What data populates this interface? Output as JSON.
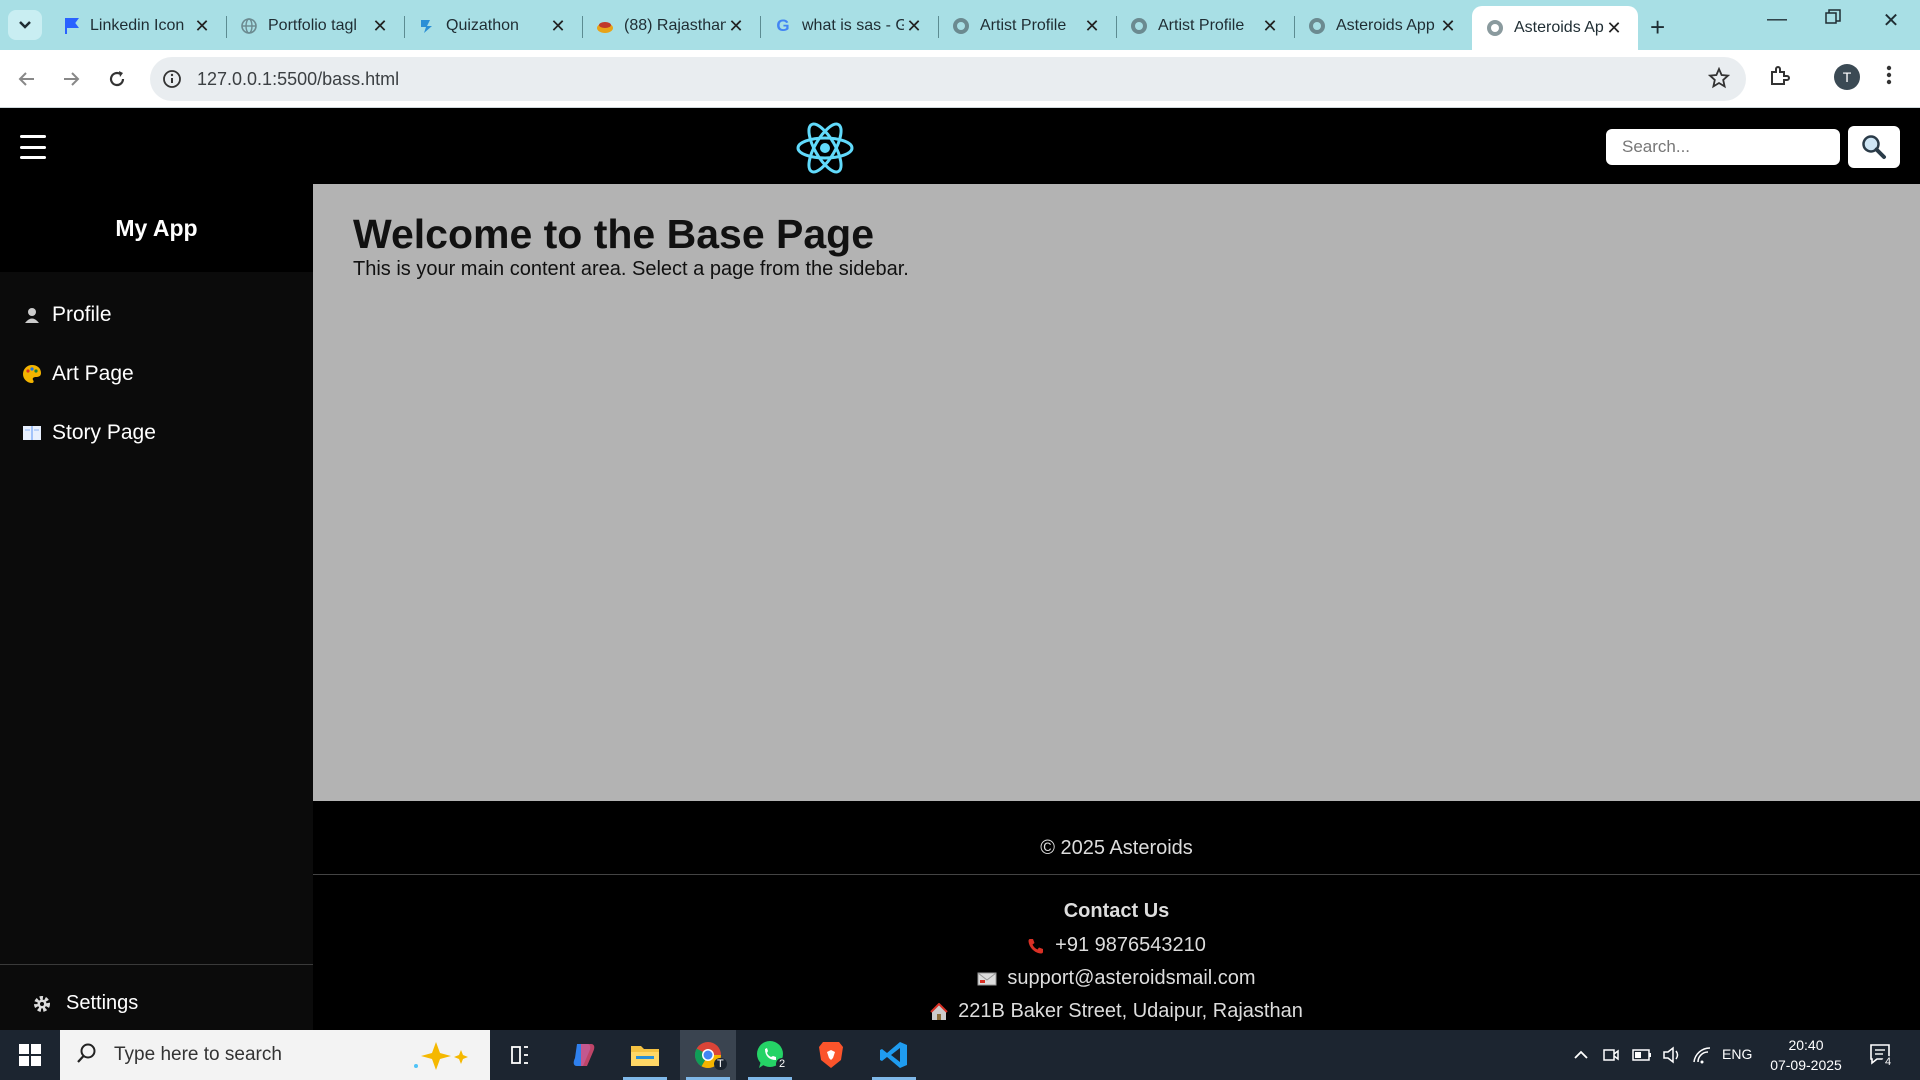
{
  "browser": {
    "tabs": [
      {
        "title": "Linkedin Icon",
        "favicon": "linkedin-flag-icon"
      },
      {
        "title": "Portfolio tagl",
        "favicon": "globe-icon"
      },
      {
        "title": "Quizathon",
        "favicon": "quizathon-icon"
      },
      {
        "title": "(88) Rajasthan",
        "favicon": "food-icon"
      },
      {
        "title": "what is sas - G",
        "favicon": "google-icon"
      },
      {
        "title": "Artist Profile",
        "favicon": "globe-icon"
      },
      {
        "title": "Artist Profile",
        "favicon": "globe-icon"
      },
      {
        "title": "Asteroids App",
        "favicon": "globe-icon"
      },
      {
        "title": "Asteroids App",
        "favicon": "globe-icon",
        "active": true
      }
    ],
    "url": "127.0.0.1:5500/bass.html",
    "profile_initial": "T"
  },
  "header": {
    "search_placeholder": "Search..."
  },
  "sidebar": {
    "title": "My App",
    "items": [
      {
        "label": "Profile",
        "icon": "👤"
      },
      {
        "label": "Art Page",
        "icon": "🎨"
      },
      {
        "label": "Story Page",
        "icon": "📖"
      }
    ],
    "settings_label": "Settings"
  },
  "main": {
    "heading": "Welcome to the Base Page",
    "description": "This is your main content area. Select a page from the sidebar."
  },
  "footer": {
    "copyright": "© 2025 Asteroids",
    "contact_title": "Contact Us",
    "phone": "+91 9876543210",
    "email": "support@asteroidsmail.com",
    "address": "221B Baker Street, Udaipur, Rajasthan"
  },
  "taskbar": {
    "search_placeholder": "Type here to search",
    "whatsapp_badge": "2",
    "chrome_badge": "T",
    "language": "ENG",
    "time": "20:40",
    "date": "07-09-2025",
    "notification_count": "4"
  },
  "colors": {
    "tabstrip": "#a8dfe5",
    "react_logo": "#61dafb",
    "main_bg": "#b3b3b3",
    "taskbar": "#1c2530"
  }
}
